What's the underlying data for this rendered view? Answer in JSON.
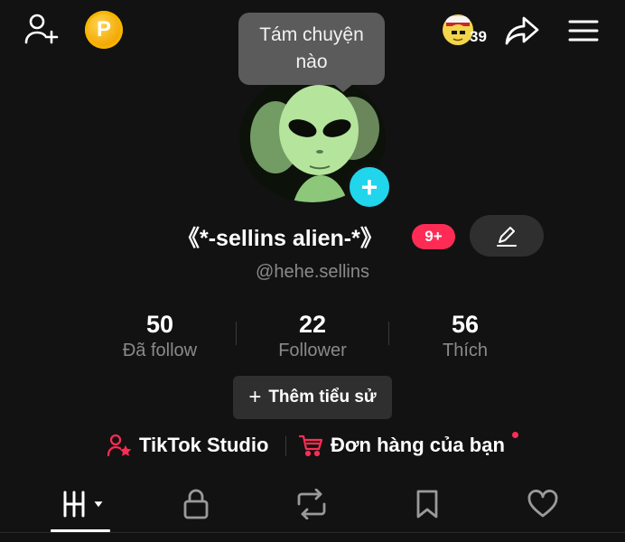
{
  "colors": {
    "background": "#121212",
    "accent_red": "#fe2c55",
    "accent_cyan": "#20d5ec",
    "coin_gold": "#f2a400",
    "muted_text": "#8a8a8a",
    "chip_bg": "#2f2f2f"
  },
  "top_bar": {
    "add_user_icon": "person-plus-icon",
    "coin_icon": "coin-p-icon",
    "coin_letter": "P",
    "streak_count": "39",
    "share_icon": "share-arrow-icon",
    "menu_icon": "hamburger-menu-icon"
  },
  "tooltip": {
    "line1": "Tám chuyện",
    "line2": "nào"
  },
  "profile": {
    "avatar_icon": "alien-avatar",
    "avatar_add_symbol": "+",
    "display_name": "《*-sellins alien-*》",
    "notification_badge": "9+",
    "edit_icon": "pencil-icon",
    "handle": "@hehe.sellins"
  },
  "stats": [
    {
      "value": "50",
      "label": "Đã follow"
    },
    {
      "value": "22",
      "label": "Follower"
    },
    {
      "value": "56",
      "label": "Thích"
    }
  ],
  "bio_button": {
    "symbol": "+",
    "label": "Thêm tiểu sử"
  },
  "links": {
    "studio_label": "TikTok Studio",
    "studio_icon": "person-star-icon",
    "orders_label": "Đơn hàng của bạn",
    "orders_icon": "cart-icon"
  },
  "tabs": [
    {
      "icon": "grid-videos-icon",
      "active": true
    },
    {
      "icon": "lock-icon",
      "active": false
    },
    {
      "icon": "repost-icon",
      "active": false
    },
    {
      "icon": "bookmark-icon",
      "active": false
    },
    {
      "icon": "heart-icon",
      "active": false
    }
  ]
}
